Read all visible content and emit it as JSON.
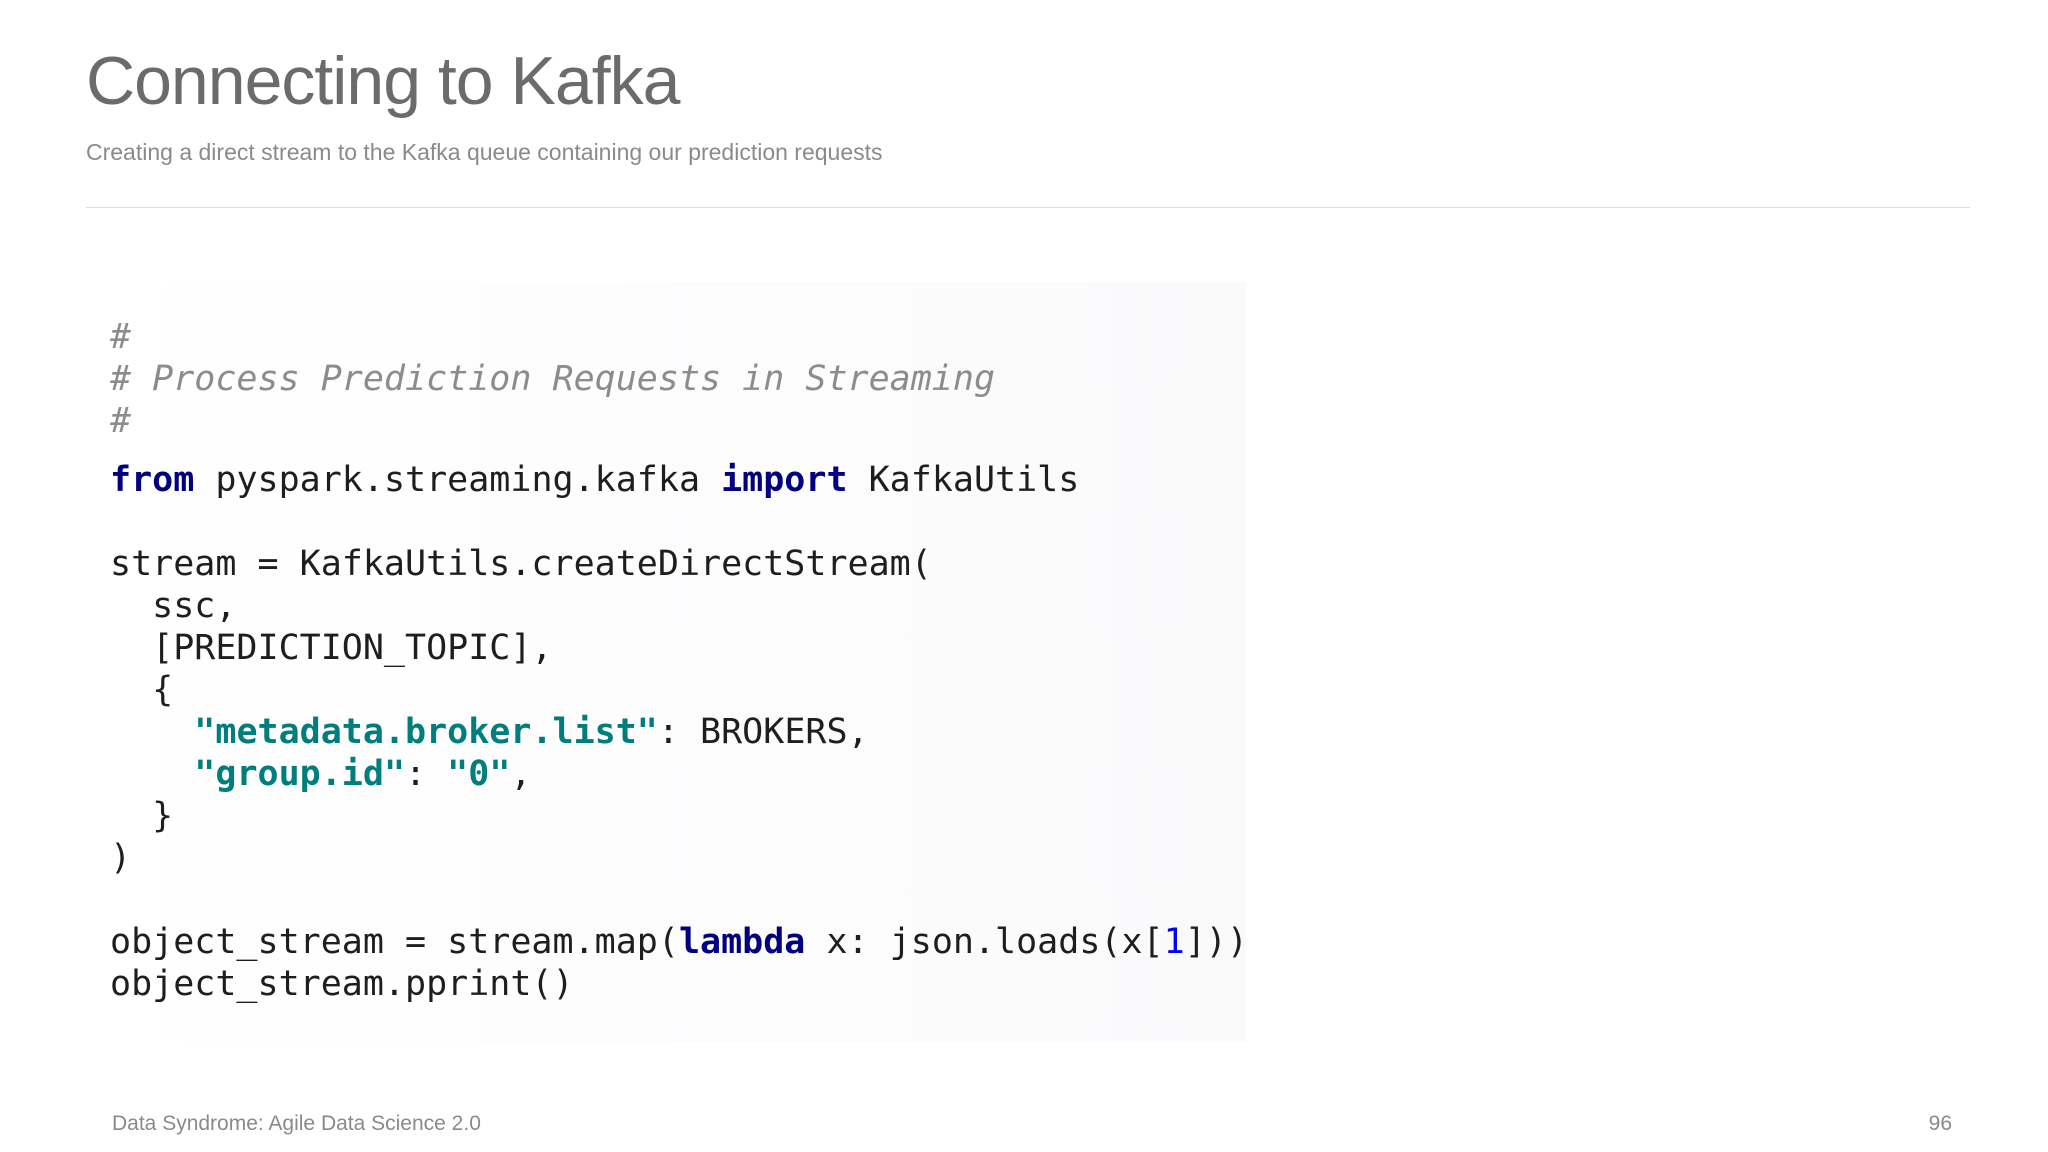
{
  "slide": {
    "title": "Connecting to Kafka",
    "subtitle": "Creating a direct stream to the Kafka queue containing our prediction requests"
  },
  "code": {
    "language": "python",
    "comment_1": "#",
    "comment_2": "# Process Prediction Requests in Streaming",
    "comment_3": "#",
    "import_from_kw": "from",
    "import_module": " pyspark.streaming.kafka ",
    "import_kw": "import",
    "import_name": " KafkaUtils",
    "stream_assign": "stream = KafkaUtils.createDirectStream(",
    "arg_ssc": "  ssc,",
    "arg_topic": "  [PREDICTION_TOPIC],",
    "dict_open": "  {",
    "dict_key_1_indent": "    ",
    "dict_key_1": "\"metadata.broker.list\"",
    "dict_val_1": ": BROKERS,",
    "dict_key_2_indent": "    ",
    "dict_key_2": "\"group.id\"",
    "dict_sep_2": ": ",
    "dict_val_2": "\"0\"",
    "dict_end_2": ",",
    "dict_close": "  }",
    "call_close": ")",
    "map_prefix": "object_stream = stream.map(",
    "map_kw": "lambda",
    "map_middle": " x: json.loads(x[",
    "map_index": "1",
    "map_suffix": "]))",
    "pprint_line": "object_stream.pprint()"
  },
  "footer": {
    "source": "Data Syndrome: Agile Data Science 2.0",
    "page_number": "96"
  },
  "colors": {
    "title": "#6b6b6b",
    "subtitle": "#8a8a8a",
    "code_text": "#1e1e1e",
    "comment": "#8c8c8c",
    "keyword": "#000080",
    "string": "#007d7d",
    "number": "#0000ff"
  }
}
